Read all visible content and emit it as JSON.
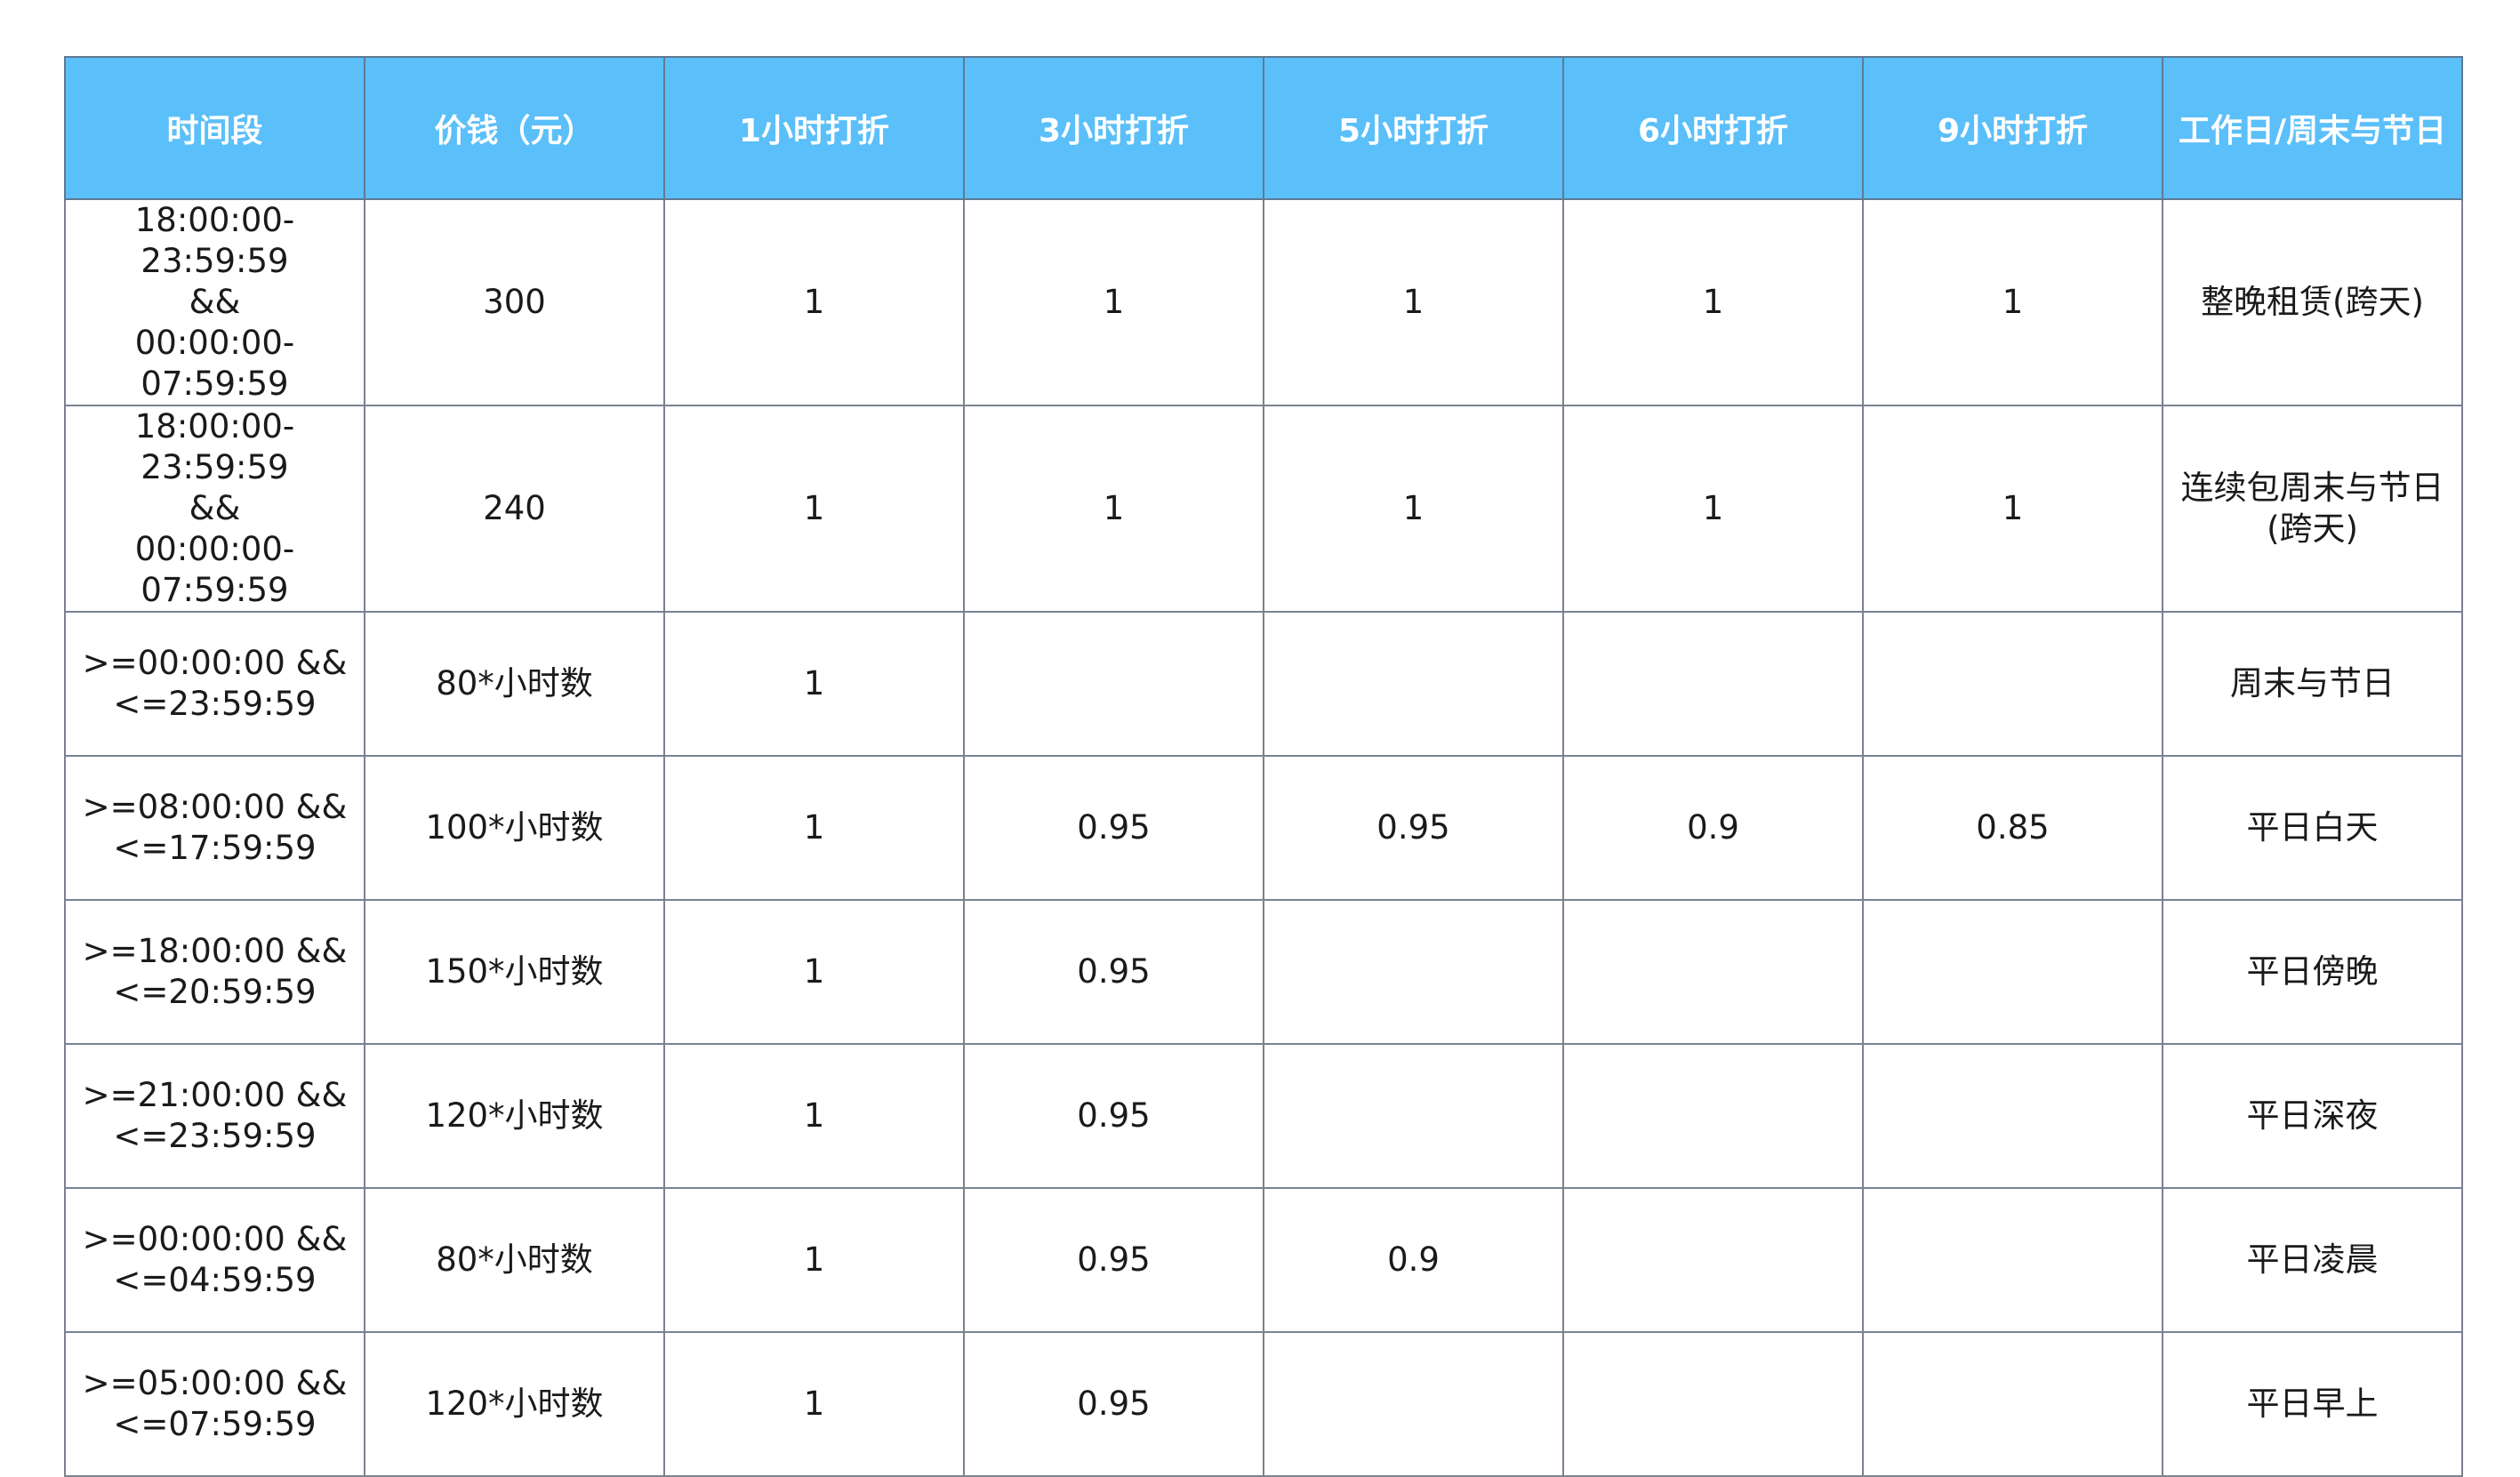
{
  "table": {
    "headers": [
      "时间段",
      "价钱（元）",
      "1小时打折",
      "3小时打折",
      "5小时打折",
      "6小时打折",
      "9小时打折",
      "工作日/周末与节日"
    ],
    "rows": [
      [
        "18:00:00-23:59:59\n&&\n00:00:00-07:59:59",
        "300",
        "1",
        "1",
        "1",
        "1",
        "1",
        "整晚租赁(跨天)"
      ],
      [
        "18:00:00-23:59:59\n&&\n00:00:00-07:59:59",
        "240",
        "1",
        "1",
        "1",
        "1",
        "1",
        "连续包周末与节日\n(跨天)"
      ],
      [
        ">=00:00:00 &&\n<=23:59:59",
        "80*小时数",
        "1",
        "",
        "",
        "",
        "",
        "周末与节日"
      ],
      [
        ">=08:00:00 &&\n<=17:59:59",
        "100*小时数",
        "1",
        "0.95",
        "0.95",
        "0.9",
        "0.85",
        "平日白天"
      ],
      [
        ">=18:00:00 &&\n<=20:59:59",
        "150*小时数",
        "1",
        "0.95",
        "",
        "",
        "",
        "平日傍晚"
      ],
      [
        ">=21:00:00 &&\n<=23:59:59",
        "120*小时数",
        "1",
        "0.95",
        "",
        "",
        "",
        "平日深夜"
      ],
      [
        ">=00:00:00 &&\n<=04:59:59",
        "80*小时数",
        "1",
        "0.95",
        "0.9",
        "",
        "",
        "平日凌晨"
      ],
      [
        ">=05:00:00 &&\n<=07:59:59",
        "120*小时数",
        "1",
        "0.95",
        "",
        "",
        "",
        "平日早上"
      ]
    ]
  }
}
